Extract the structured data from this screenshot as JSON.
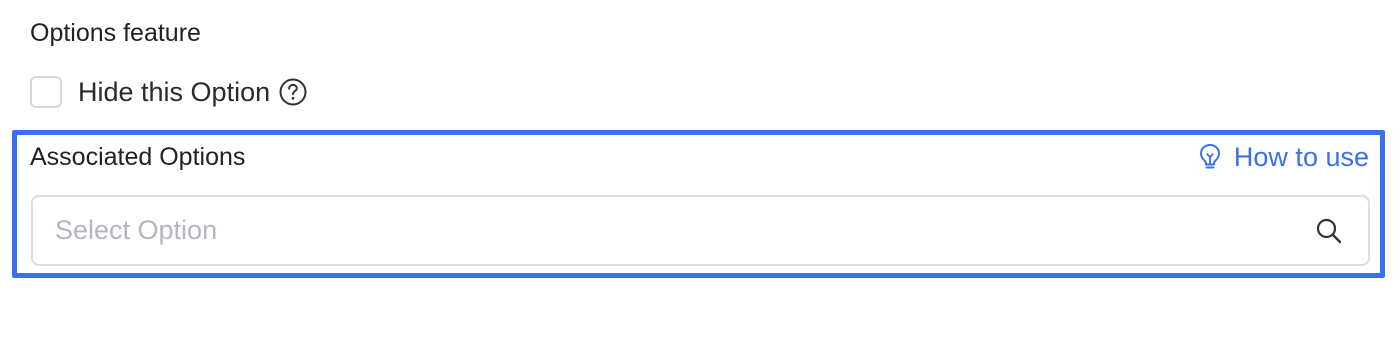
{
  "options_feature": {
    "title": "Options feature",
    "hide_option_label": "Hide this Option",
    "hide_option_checked": false
  },
  "associated_options": {
    "title": "Associated Options",
    "how_to_use_label": "How to use",
    "select_placeholder": "Select Option",
    "select_value": ""
  },
  "icons": {
    "help": "question-circle-icon",
    "how_to_use": "lightbulb-icon",
    "search": "search-icon"
  },
  "colors": {
    "accent": "#3a6ff0",
    "highlight_border": "#3a6ff0",
    "input_border": "#dcdde3",
    "placeholder": "#b3b6c0",
    "text": "#222222"
  }
}
